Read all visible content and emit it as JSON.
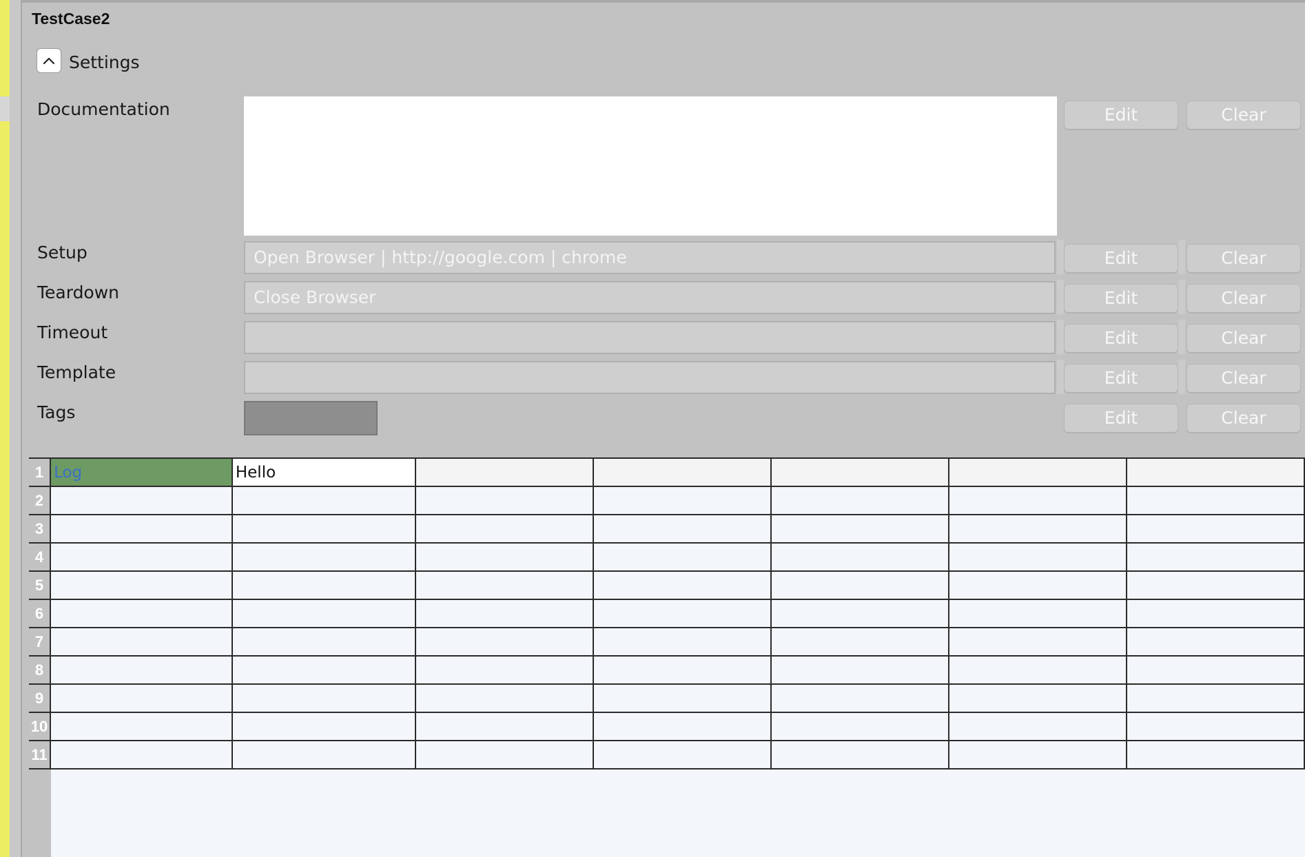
{
  "testcase": {
    "title": "TestCase2"
  },
  "settings": {
    "header_label": "Settings",
    "fields": [
      {
        "label": "Documentation",
        "value": "",
        "edit": "Edit",
        "clear": "Clear"
      },
      {
        "label": "Setup",
        "value": "Open Browser | http://google.com | chrome",
        "edit": "Edit",
        "clear": "Clear"
      },
      {
        "label": "Teardown",
        "value": "Close Browser",
        "edit": "Edit",
        "clear": "Clear"
      },
      {
        "label": "Timeout",
        "value": "",
        "edit": "Edit",
        "clear": "Clear"
      },
      {
        "label": "Template",
        "value": "",
        "edit": "Edit",
        "clear": "Clear"
      },
      {
        "label": "Tags",
        "value": "",
        "edit": "Edit",
        "clear": "Clear"
      }
    ]
  },
  "grid": {
    "row_numbers": [
      "1",
      "2",
      "3",
      "4",
      "5",
      "6",
      "7",
      "8",
      "9",
      "10",
      "11"
    ],
    "rows": [
      [
        "Log",
        "Hello",
        "",
        "",
        "",
        "",
        ""
      ]
    ]
  },
  "colors": {
    "keyword_cell": "#6e9a64",
    "keyword_text": "#3a72c4",
    "side_strip": "#eded63"
  }
}
